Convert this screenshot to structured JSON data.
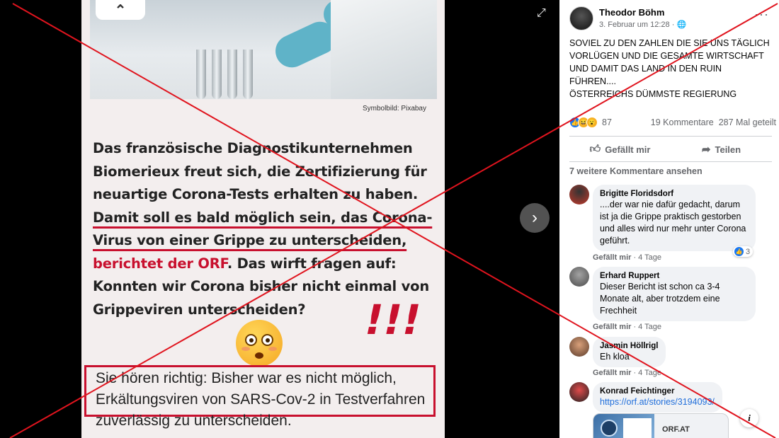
{
  "viewer": {
    "photo_caption": "Symbolbild: Pixabay",
    "headline": {
      "part1": "Das französische Diagnostikunternehmen Biomerieux freut sich, die Zertifizierung für neuartige Corona-Tests erhalten zu haben. ",
      "underlined1": "Damit soll es bald möglich sein, das Corona-Virus von einer Grippe zu unterscheiden,",
      "red": " berichtet der ORF",
      "part2": ". Das wirft fragen auf: Konnten wir Corona bisher nicht einmal von Grippeviren unterscheiden?"
    },
    "exclamation": "!!!",
    "boxed_text": "Sie hören richtig: Bisher war es nicht möglich, Erkältungsviren von SARS-Cov-2 in Testverfahren zuverlässig zu unterscheiden.",
    "prev_icon": "chevron-up-icon",
    "next_icon": "chevron-right-icon",
    "expand_icon": "expand-icon",
    "prev_glyph": "⌃",
    "next_glyph": "›",
    "expand_glyph": "⤢"
  },
  "post": {
    "author": "Theodor Böhm",
    "meta": "3. Februar um 12:28 · 🌐",
    "more": "···",
    "text_lines": [
      "SOVIEL ZU DEN ZAHLEN DIE SIE UNS TÄGLICH",
      "VORLÜGEN UND DIE GESAMTE WIRTSCHAFT",
      "UND DAMIT DAS LAND IN DEN RUIN",
      "FÜHREN....",
      "ÖSTERREICHS DÜMMSTE REGIERUNG"
    ],
    "reaction_count": "87",
    "comments_count": "19 Kommentare",
    "shares_count": "287 Mal geteilt",
    "like_label": "Gefällt mir",
    "share_label": "Teilen",
    "more_comments": "7 weitere Kommentare ansehen"
  },
  "comments": [
    {
      "name": "Brigitte Floridsdorf",
      "text": "....der war nie dafür gedacht, darum ist ja die Grippe praktisch gestorben und alles wird nur mehr unter Corona geführt.",
      "like": "Gefällt mir",
      "age": " · 4 Tage",
      "likes": "3"
    },
    {
      "name": "Erhard Ruppert",
      "text": "Dieser Bericht ist schon ca 3-4 Monate alt, aber trotzdem eine Frechheit",
      "like": "Gefällt mir",
      "age": " · 4 Tage"
    },
    {
      "name": "Jasmin Höllrigl",
      "text": "Eh kloa",
      "like": "Gefällt mir",
      "age": " · 4 Tage"
    },
    {
      "name": "Konrad Feichtinger",
      "text": "https://orf.at/stories/3194093/",
      "link_card": "ORF.AT"
    }
  ],
  "colors": {
    "facebook_blue": "#1877f2",
    "link": "#216fdb",
    "overlay_x": "#e0141e",
    "highlight_red": "#c8102e"
  }
}
